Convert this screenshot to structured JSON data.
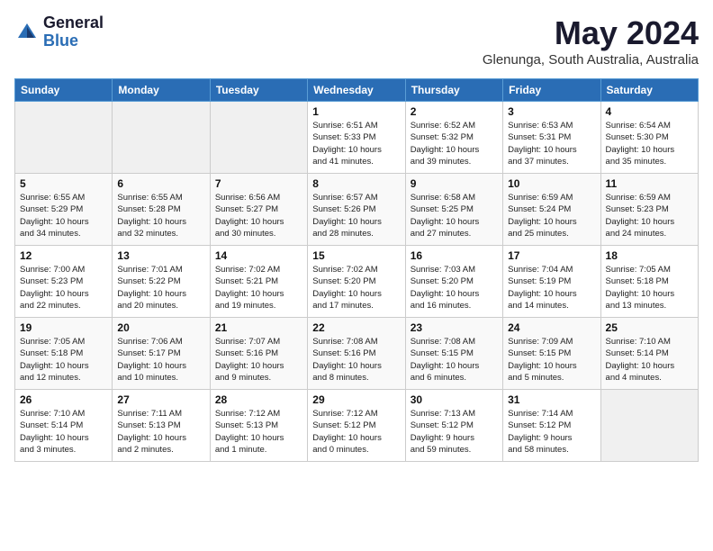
{
  "logo": {
    "general": "General",
    "blue": "Blue"
  },
  "title": {
    "month": "May 2024",
    "location": "Glenunga, South Australia, Australia"
  },
  "weekdays": [
    "Sunday",
    "Monday",
    "Tuesday",
    "Wednesday",
    "Thursday",
    "Friday",
    "Saturday"
  ],
  "weeks": [
    [
      {
        "day": "",
        "info": ""
      },
      {
        "day": "",
        "info": ""
      },
      {
        "day": "",
        "info": ""
      },
      {
        "day": "1",
        "info": "Sunrise: 6:51 AM\nSunset: 5:33 PM\nDaylight: 10 hours\nand 41 minutes."
      },
      {
        "day": "2",
        "info": "Sunrise: 6:52 AM\nSunset: 5:32 PM\nDaylight: 10 hours\nand 39 minutes."
      },
      {
        "day": "3",
        "info": "Sunrise: 6:53 AM\nSunset: 5:31 PM\nDaylight: 10 hours\nand 37 minutes."
      },
      {
        "day": "4",
        "info": "Sunrise: 6:54 AM\nSunset: 5:30 PM\nDaylight: 10 hours\nand 35 minutes."
      }
    ],
    [
      {
        "day": "5",
        "info": "Sunrise: 6:55 AM\nSunset: 5:29 PM\nDaylight: 10 hours\nand 34 minutes."
      },
      {
        "day": "6",
        "info": "Sunrise: 6:55 AM\nSunset: 5:28 PM\nDaylight: 10 hours\nand 32 minutes."
      },
      {
        "day": "7",
        "info": "Sunrise: 6:56 AM\nSunset: 5:27 PM\nDaylight: 10 hours\nand 30 minutes."
      },
      {
        "day": "8",
        "info": "Sunrise: 6:57 AM\nSunset: 5:26 PM\nDaylight: 10 hours\nand 28 minutes."
      },
      {
        "day": "9",
        "info": "Sunrise: 6:58 AM\nSunset: 5:25 PM\nDaylight: 10 hours\nand 27 minutes."
      },
      {
        "day": "10",
        "info": "Sunrise: 6:59 AM\nSunset: 5:24 PM\nDaylight: 10 hours\nand 25 minutes."
      },
      {
        "day": "11",
        "info": "Sunrise: 6:59 AM\nSunset: 5:23 PM\nDaylight: 10 hours\nand 24 minutes."
      }
    ],
    [
      {
        "day": "12",
        "info": "Sunrise: 7:00 AM\nSunset: 5:23 PM\nDaylight: 10 hours\nand 22 minutes."
      },
      {
        "day": "13",
        "info": "Sunrise: 7:01 AM\nSunset: 5:22 PM\nDaylight: 10 hours\nand 20 minutes."
      },
      {
        "day": "14",
        "info": "Sunrise: 7:02 AM\nSunset: 5:21 PM\nDaylight: 10 hours\nand 19 minutes."
      },
      {
        "day": "15",
        "info": "Sunrise: 7:02 AM\nSunset: 5:20 PM\nDaylight: 10 hours\nand 17 minutes."
      },
      {
        "day": "16",
        "info": "Sunrise: 7:03 AM\nSunset: 5:20 PM\nDaylight: 10 hours\nand 16 minutes."
      },
      {
        "day": "17",
        "info": "Sunrise: 7:04 AM\nSunset: 5:19 PM\nDaylight: 10 hours\nand 14 minutes."
      },
      {
        "day": "18",
        "info": "Sunrise: 7:05 AM\nSunset: 5:18 PM\nDaylight: 10 hours\nand 13 minutes."
      }
    ],
    [
      {
        "day": "19",
        "info": "Sunrise: 7:05 AM\nSunset: 5:18 PM\nDaylight: 10 hours\nand 12 minutes."
      },
      {
        "day": "20",
        "info": "Sunrise: 7:06 AM\nSunset: 5:17 PM\nDaylight: 10 hours\nand 10 minutes."
      },
      {
        "day": "21",
        "info": "Sunrise: 7:07 AM\nSunset: 5:16 PM\nDaylight: 10 hours\nand 9 minutes."
      },
      {
        "day": "22",
        "info": "Sunrise: 7:08 AM\nSunset: 5:16 PM\nDaylight: 10 hours\nand 8 minutes."
      },
      {
        "day": "23",
        "info": "Sunrise: 7:08 AM\nSunset: 5:15 PM\nDaylight: 10 hours\nand 6 minutes."
      },
      {
        "day": "24",
        "info": "Sunrise: 7:09 AM\nSunset: 5:15 PM\nDaylight: 10 hours\nand 5 minutes."
      },
      {
        "day": "25",
        "info": "Sunrise: 7:10 AM\nSunset: 5:14 PM\nDaylight: 10 hours\nand 4 minutes."
      }
    ],
    [
      {
        "day": "26",
        "info": "Sunrise: 7:10 AM\nSunset: 5:14 PM\nDaylight: 10 hours\nand 3 minutes."
      },
      {
        "day": "27",
        "info": "Sunrise: 7:11 AM\nSunset: 5:13 PM\nDaylight: 10 hours\nand 2 minutes."
      },
      {
        "day": "28",
        "info": "Sunrise: 7:12 AM\nSunset: 5:13 PM\nDaylight: 10 hours\nand 1 minute."
      },
      {
        "day": "29",
        "info": "Sunrise: 7:12 AM\nSunset: 5:12 PM\nDaylight: 10 hours\nand 0 minutes."
      },
      {
        "day": "30",
        "info": "Sunrise: 7:13 AM\nSunset: 5:12 PM\nDaylight: 9 hours\nand 59 minutes."
      },
      {
        "day": "31",
        "info": "Sunrise: 7:14 AM\nSunset: 5:12 PM\nDaylight: 9 hours\nand 58 minutes."
      },
      {
        "day": "",
        "info": ""
      }
    ]
  ]
}
